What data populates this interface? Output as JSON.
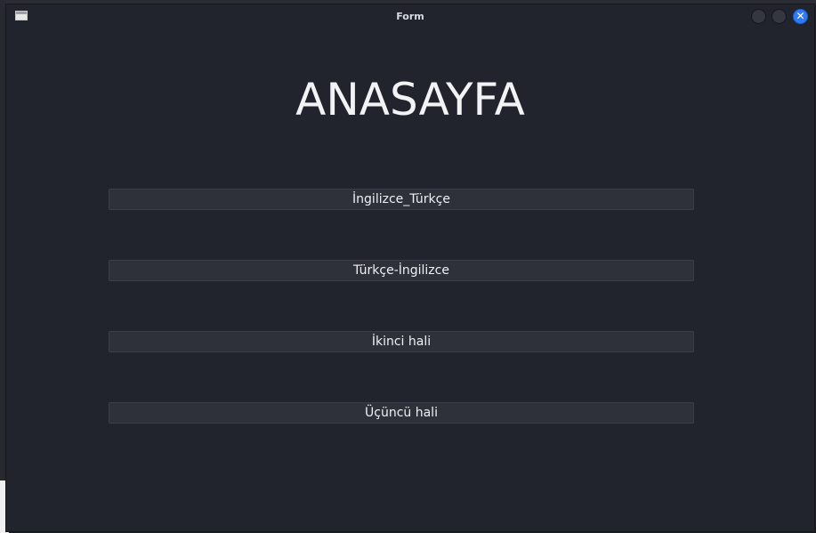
{
  "window": {
    "title": "Form",
    "close_glyph": "✕",
    "icons": {
      "app": "window-icon",
      "minimize": "minimize-icon",
      "maximize": "maximize-icon",
      "close": "close-icon"
    },
    "accent_color": "#2f7bf5"
  },
  "main": {
    "heading": "ANASAYFA",
    "buttons": [
      {
        "label": "İngilizce_Türkçe"
      },
      {
        "label": "Türkçe-İngilizce"
      },
      {
        "label": "İkinci hali"
      },
      {
        "label": "Üçüncü hali"
      }
    ]
  }
}
